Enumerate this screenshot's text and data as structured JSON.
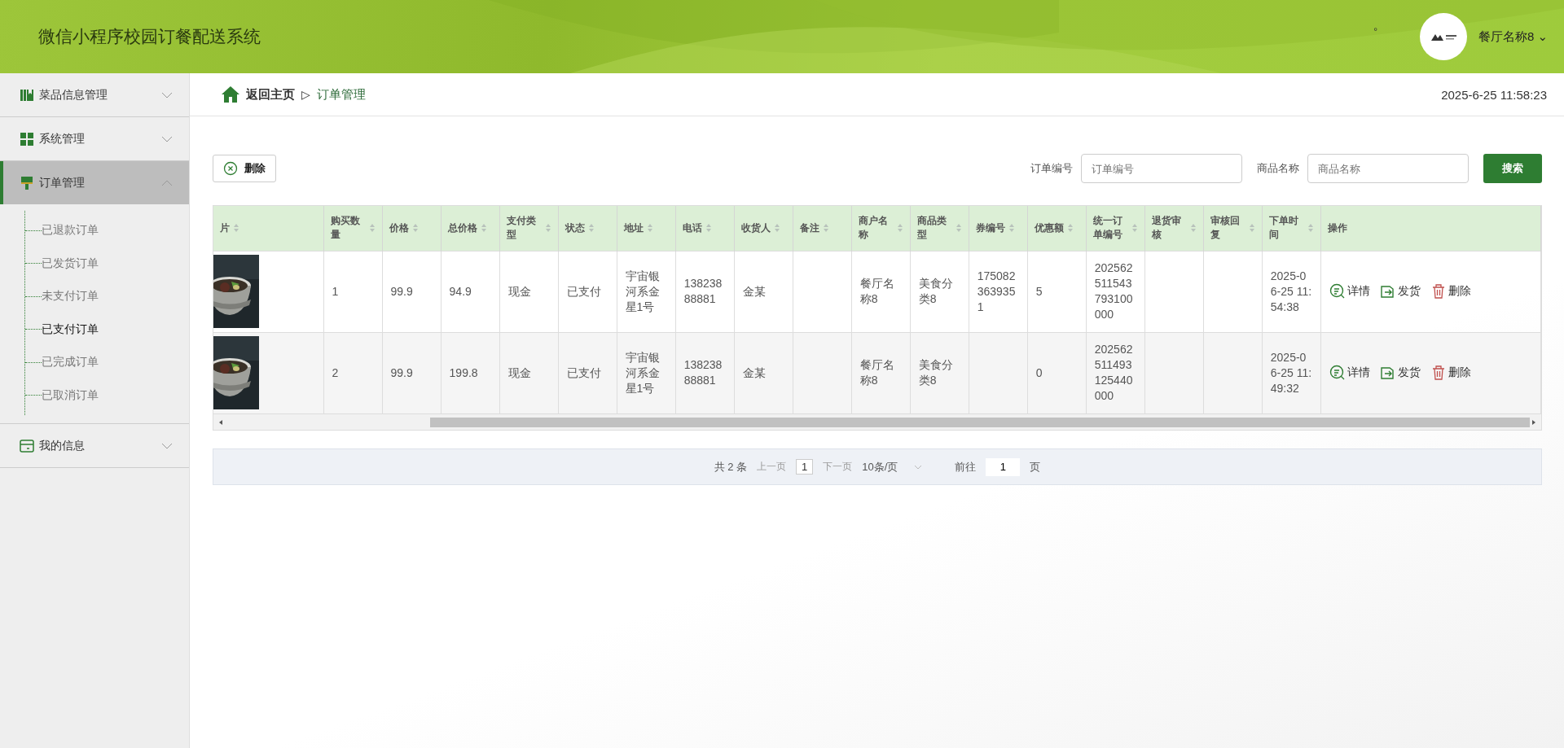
{
  "header": {
    "title": "微信小程序校园订餐配送系统",
    "dot": "°",
    "user": {
      "name": "餐厅名称8",
      "caret": "⌄"
    }
  },
  "sidebar": {
    "items": [
      {
        "label": "菜品信息管理",
        "expanded": false,
        "selected": false
      },
      {
        "label": "系统管理",
        "expanded": false,
        "selected": false
      },
      {
        "label": "订单管理",
        "expanded": true,
        "selected": true,
        "children": [
          {
            "label": "已退款订单",
            "selected": false
          },
          {
            "label": "已发货订单",
            "selected": false
          },
          {
            "label": "未支付订单",
            "selected": false
          },
          {
            "label": "已支付订单",
            "selected": true
          },
          {
            "label": "已完成订单",
            "selected": false
          },
          {
            "label": "已取消订单",
            "selected": false
          }
        ]
      },
      {
        "label": "我的信息",
        "expanded": false,
        "selected": false
      }
    ]
  },
  "breadcrumb": {
    "home": "返回主页",
    "separator": "▷",
    "current": "订单管理",
    "datetime": "2025-6-25 11:58:23"
  },
  "toolbar": {
    "delete_button": "删除",
    "filters": [
      {
        "label": "订单编号",
        "placeholder": "订单编号"
      },
      {
        "label": "商品名称",
        "placeholder": "商品名称"
      }
    ],
    "search_button": "搜索"
  },
  "table": {
    "columns": [
      {
        "label": "片",
        "sortable": true
      },
      {
        "label": "购买数量",
        "sortable": true
      },
      {
        "label": "价格",
        "sortable": true
      },
      {
        "label": "总价格",
        "sortable": true
      },
      {
        "label": "支付类型",
        "sortable": true
      },
      {
        "label": "状态",
        "sortable": true
      },
      {
        "label": "地址",
        "sortable": true
      },
      {
        "label": "电话",
        "sortable": true
      },
      {
        "label": "收货人",
        "sortable": true
      },
      {
        "label": "备注",
        "sortable": true
      },
      {
        "label": "商户名称",
        "sortable": true
      },
      {
        "label": "商品类型",
        "sortable": true
      },
      {
        "label": "券编号",
        "sortable": true
      },
      {
        "label": "优惠额",
        "sortable": true
      },
      {
        "label": "统一订单编号",
        "sortable": true
      },
      {
        "label": "退货审核",
        "sortable": true
      },
      {
        "label": "审核回复",
        "sortable": true
      },
      {
        "label": "下单时间",
        "sortable": true
      },
      {
        "label": "操作",
        "sortable": false
      }
    ],
    "rows": [
      {
        "image": {
          "kind": "picture"
        },
        "cells": [
          "",
          "1",
          "99.9",
          "94.9",
          "现金",
          "已支付",
          "宇宙银河系金星1号",
          "13823888881",
          "金某",
          "",
          "餐厅名称8",
          "美食分类8",
          "1750823639351",
          "5",
          "202562511543793100000",
          "",
          "",
          "2025-06-25 11:54:38"
        ],
        "actions": [
          "详情",
          "发货",
          "删除"
        ]
      },
      {
        "image": {
          "kind": "picture"
        },
        "cells": [
          "",
          "2",
          "99.9",
          "199.8",
          "现金",
          "已支付",
          "宇宙银河系金星1号",
          "13823888881",
          "金某",
          "",
          "餐厅名称8",
          "美食分类8",
          "",
          "0",
          "202562511493125440000",
          "",
          "",
          "2025-06-25 11:49:32"
        ],
        "actions": [
          "详情",
          "发货",
          "删除"
        ]
      }
    ]
  },
  "pagination": {
    "total": "共 2 条",
    "prev": "上一页",
    "page": "1",
    "next": "下一页",
    "page_size": "10条/页",
    "goto": "前往",
    "goto_value": "1",
    "page_unit": "页"
  }
}
